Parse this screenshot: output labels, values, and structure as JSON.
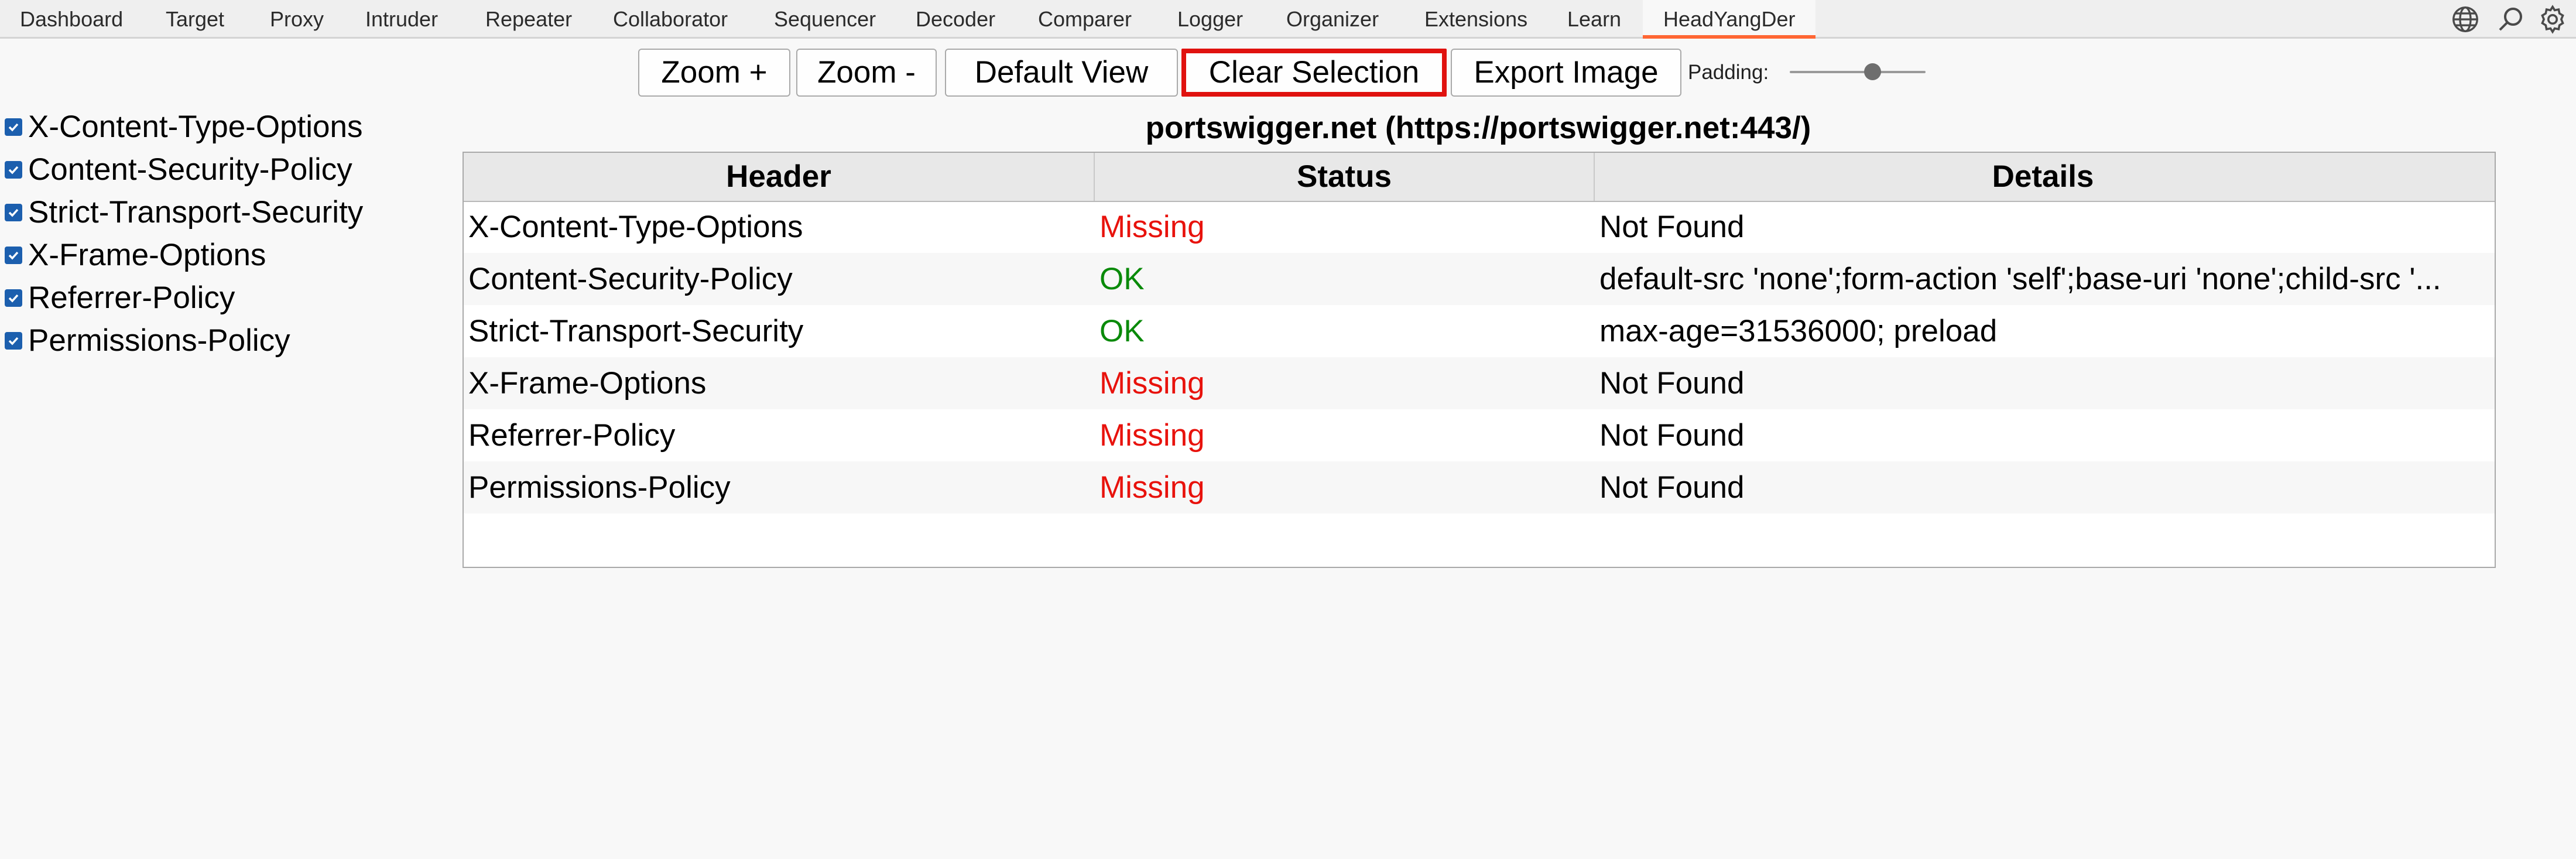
{
  "tabs": [
    {
      "label": "Dashboard"
    },
    {
      "label": "Target"
    },
    {
      "label": "Proxy"
    },
    {
      "label": "Intruder"
    },
    {
      "label": "Repeater"
    },
    {
      "label": "Collaborator"
    },
    {
      "label": "Sequencer"
    },
    {
      "label": "Decoder"
    },
    {
      "label": "Comparer"
    },
    {
      "label": "Logger"
    },
    {
      "label": "Organizer"
    },
    {
      "label": "Extensions"
    },
    {
      "label": "Learn"
    },
    {
      "label": "HeadYangDer"
    }
  ],
  "active_tab": "HeadYangDer",
  "top_icons": [
    "globe-icon",
    "search-icon",
    "gear-icon"
  ],
  "toolbar": {
    "zoom_in": "Zoom +",
    "zoom_out": "Zoom -",
    "default_view": "Default View",
    "clear_selection": "Clear Selection",
    "export_image": "Export Image",
    "padding_label": "Padding:",
    "padding_level": 0.6
  },
  "filters": [
    {
      "label": "X-Content-Type-Options",
      "checked": true
    },
    {
      "label": "Content-Security-Policy",
      "checked": true
    },
    {
      "label": "Strict-Transport-Security",
      "checked": true
    },
    {
      "label": "X-Frame-Options",
      "checked": true
    },
    {
      "label": "Referrer-Policy",
      "checked": true
    },
    {
      "label": "Permissions-Policy",
      "checked": true
    }
  ],
  "site_title": "portswigger.net (https://portswigger.net:443/)",
  "table": {
    "columns": [
      "Header",
      "Status",
      "Details"
    ],
    "rows": [
      {
        "header": "X-Content-Type-Options",
        "status": "Missing",
        "details": "Not Found"
      },
      {
        "header": "Content-Security-Policy",
        "status": "OK",
        "details": "default-src 'none';form-action 'self';base-uri 'none';child-src '..."
      },
      {
        "header": "Strict-Transport-Security",
        "status": "OK",
        "details": "max-age=31536000; preload"
      },
      {
        "header": "X-Frame-Options",
        "status": "Missing",
        "details": "Not Found"
      },
      {
        "header": "Referrer-Policy",
        "status": "Missing",
        "details": "Not Found"
      },
      {
        "header": "Permissions-Policy",
        "status": "Missing",
        "details": "Not Found"
      }
    ]
  },
  "colors": {
    "missing": "#e8120c",
    "ok": "#0a8a0a",
    "accent": "#ff6633",
    "highlight_border": "#e0120f",
    "checkbox": "#1c5fae"
  }
}
